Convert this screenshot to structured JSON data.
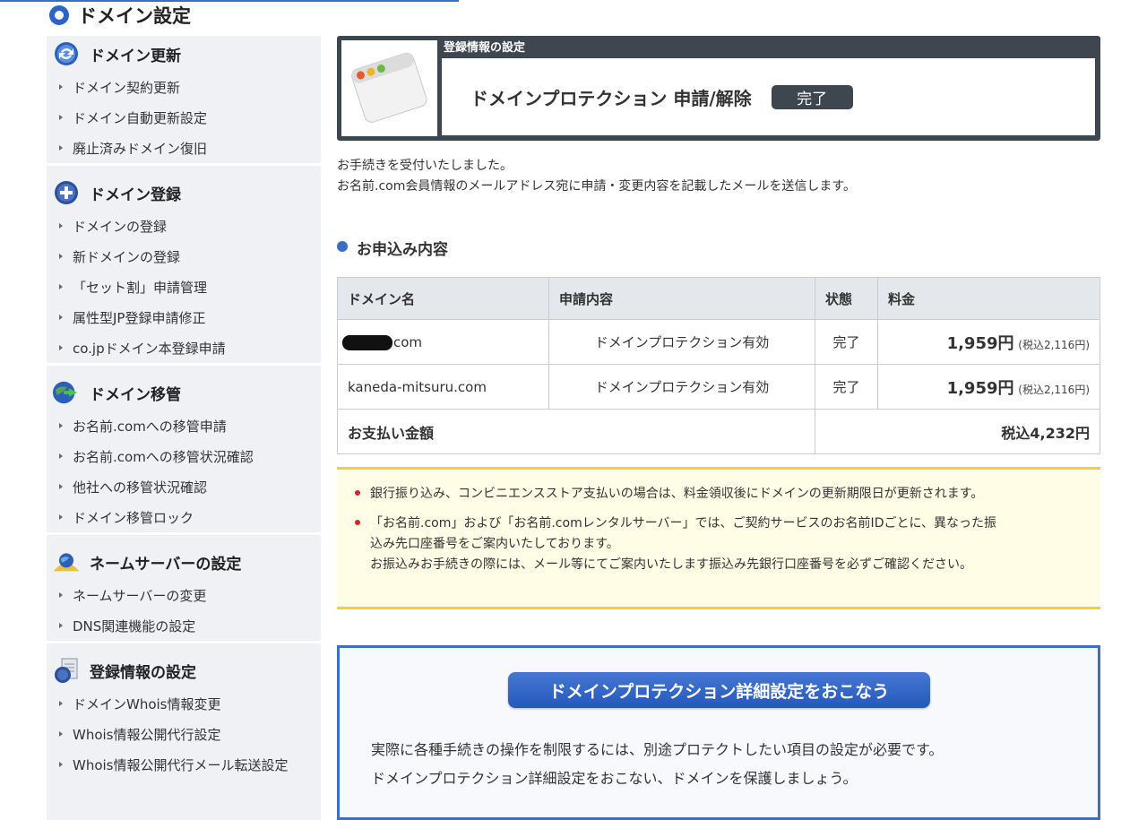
{
  "page": {
    "title": "ドメイン設定"
  },
  "sidebar": {
    "sections": [
      {
        "title": "ドメイン更新",
        "icon": "refresh-icon",
        "items": [
          "ドメイン契約更新",
          "ドメイン自動更新設定",
          "廃止済みドメイン復旧"
        ]
      },
      {
        "title": "ドメイン登録",
        "icon": "plus-icon",
        "items": [
          "ドメインの登録",
          "新ドメインの登録",
          "「セット割」申請管理",
          "属性型JP登録申請修正",
          "co.jpドメイン本登録申請"
        ]
      },
      {
        "title": "ドメイン移管",
        "icon": "globe-transfer-icon",
        "items": [
          "お名前.comへの移管申請",
          "お名前.comへの移管状況確認",
          "他社への移管状況確認",
          "ドメイン移管ロック"
        ]
      },
      {
        "title": "ネームサーバーの設定",
        "icon": "server-globe-icon",
        "items": [
          "ネームサーバーの変更",
          "DNS関連機能の設定"
        ]
      },
      {
        "title": "登録情報の設定",
        "icon": "document-globe-icon",
        "items": [
          "ドメインWhois情報変更",
          "Whois情報公開代行設定",
          "Whois情報公開代行メール転送設定"
        ]
      }
    ]
  },
  "header": {
    "tag": "登録情報の設定",
    "title": "ドメインプロテクション 申請/解除",
    "badge": "完了"
  },
  "message": {
    "line1": "お手続きを受付いたしました。",
    "line2": "お名前.com会員情報のメールアドレス宛に申請・変更内容を記載したメールを送信します。"
  },
  "order": {
    "heading": "お申込み内容",
    "columns": [
      "ドメイン名",
      "申請内容",
      "状態",
      "料金"
    ],
    "rows": [
      {
        "domain_suffix": "com",
        "content": "ドメインプロテクション有効",
        "status": "完了",
        "price": "1,959円",
        "tax": "(税込2,116円)"
      },
      {
        "domain": "kaneda-mitsuru.com",
        "content": "ドメインプロテクション有効",
        "status": "完了",
        "price": "1,959円",
        "tax": "(税込2,116円)"
      }
    ],
    "total_label": "お支払い金額",
    "total_value": "税込4,232円"
  },
  "notice": {
    "item1": "銀行振り込み、コンビニエンスストア支払いの場合は、料金領収後にドメインの更新期限日が更新されます。",
    "item2_line1": "「お名前.com」および「お名前.comレンタルサーバー」では、ご契約サービスのお名前IDごとに、異なった振",
    "item2_line2": "込み先口座番号をご案内いたしております。",
    "item2_line3": "お振込みお手続きの際には、メール等にてご案内いたします振込み先銀行口座番号を必ずご確認ください。"
  },
  "cta": {
    "button": "ドメインプロテクション詳細設定をおこなう",
    "line1": "実際に各種手続きの操作を制限するには、別途プロテクトしたい項目の設定が必要です。",
    "line2": "ドメインプロテクション詳細設定をおこない、ドメインを保護しましょう。"
  },
  "colors": {
    "accent": "#3b6fc4",
    "header_dark": "#3e4650",
    "notice_bg": "#fffde6",
    "notice_border": "#f2cf3c"
  }
}
